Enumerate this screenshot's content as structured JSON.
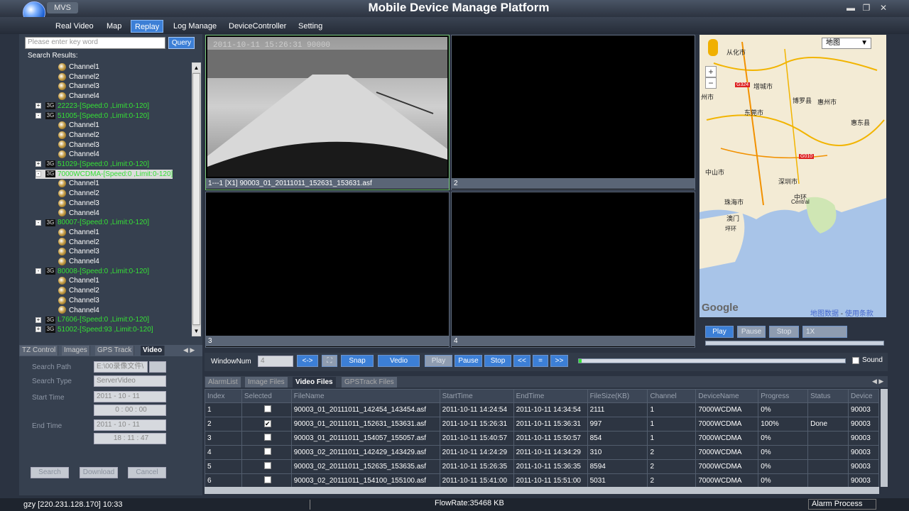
{
  "app": {
    "badge": "MVS",
    "title": "Mobile Device Manage Platform"
  },
  "menu": [
    "Real Video",
    "Map",
    "Replay",
    "Log Manage",
    "DeviceController",
    "Setting"
  ],
  "search": {
    "placeholder": "Please enter key word",
    "query_label": "Query",
    "results_label": "Search Results:"
  },
  "tree": [
    {
      "type": "ch",
      "label": "Channel1"
    },
    {
      "type": "ch",
      "label": "Channel2"
    },
    {
      "type": "ch",
      "label": "Channel3"
    },
    {
      "type": "ch",
      "label": "Channel4"
    },
    {
      "type": "dev",
      "expand": "+",
      "label": "22223-[Speed:0    ,Limit:0-120]"
    },
    {
      "type": "dev",
      "expand": "-",
      "label": "51005-[Speed:0    ,Limit:0-120]"
    },
    {
      "type": "ch",
      "label": "Channel1"
    },
    {
      "type": "ch",
      "label": "Channel2"
    },
    {
      "type": "ch",
      "label": "Channel3"
    },
    {
      "type": "ch",
      "label": "Channel4"
    },
    {
      "type": "dev",
      "expand": "+",
      "label": "51029-[Speed:0    ,Limit:0-120]"
    },
    {
      "type": "devsel",
      "expand": "-",
      "label": "7000WCDMA-[Speed:0    ,Limit:0-120]"
    },
    {
      "type": "ch",
      "label": "Channel1"
    },
    {
      "type": "ch",
      "label": "Channel2"
    },
    {
      "type": "ch",
      "label": "Channel3"
    },
    {
      "type": "ch",
      "label": "Channel4"
    },
    {
      "type": "dev",
      "expand": "-",
      "label": "80007-[Speed:0    ,Limit:0-120]"
    },
    {
      "type": "ch",
      "label": "Channel1"
    },
    {
      "type": "ch",
      "label": "Channel2"
    },
    {
      "type": "ch",
      "label": "Channel3"
    },
    {
      "type": "ch",
      "label": "Channel4"
    },
    {
      "type": "dev",
      "expand": "-",
      "label": "80008-[Speed:0    ,Limit:0-120]"
    },
    {
      "type": "ch",
      "label": "Channel1"
    },
    {
      "type": "ch",
      "label": "Channel2"
    },
    {
      "type": "ch",
      "label": "Channel3"
    },
    {
      "type": "ch",
      "label": "Channel4"
    },
    {
      "type": "dev",
      "expand": "+",
      "label": "L7606-[Speed:0    ,Limit:0-120]"
    },
    {
      "type": "dev",
      "expand": "+",
      "label": "51002-[Speed:93  ,Limit:0-120]"
    }
  ],
  "tree_badge": "3G",
  "left_tabs": [
    "TZ Control",
    "Images",
    "GPS Track",
    "Video"
  ],
  "video_form": {
    "search_path_label": "Search Path",
    "search_path_value": "E:\\00录像文件\\",
    "search_type_label": "Search Type",
    "search_type_value": "ServerVideo",
    "start_time_label": "Start Time",
    "start_date": "2011 - 10 - 11",
    "start_time": "0 : 00 : 00",
    "end_time_label": "End Time",
    "end_date": "2011 - 10 - 11",
    "end_time": "18 : 11 : 47",
    "search_btn": "Search",
    "download_btn": "Download",
    "cancel_btn": "Cancel"
  },
  "videos": [
    {
      "label": "1---1 [X1] 90003_01_20111011_152631_153631.asf"
    },
    {
      "label": "2"
    },
    {
      "label": "3"
    },
    {
      "label": "4"
    }
  ],
  "overlay_text": "2011-10-11 15:26:31  90000",
  "map": {
    "layer_select": "地图",
    "cities": [
      {
        "name": "从化市"
      },
      {
        "name": "增城市"
      },
      {
        "name": "博罗县"
      },
      {
        "name": "惠州市"
      },
      {
        "name": "东莞市"
      },
      {
        "name": "惠东县"
      },
      {
        "name": "中山市"
      },
      {
        "name": "深圳市"
      },
      {
        "name": "珠海市"
      },
      {
        "name": "澳门"
      },
      {
        "name": "中环"
      },
      {
        "name": "Central"
      },
      {
        "name": "州市"
      },
      {
        "name": "G324"
      },
      {
        "name": "G010"
      },
      {
        "name": "坪环"
      }
    ],
    "google": "Google",
    "credit1": "地图数据",
    "credit_sep": "-",
    "credit2": "使用条款",
    "zoom_in": "+",
    "zoom_out": "−"
  },
  "map_controls": {
    "play": "Play",
    "pause": "Pause",
    "stop": "Stop",
    "speed": "1X"
  },
  "controls": {
    "window_num_label": "WindowNum",
    "window_num_value": "4",
    "swap": "<->",
    "snap": "Snap",
    "vedio": "Vedio",
    "play": "Play",
    "pause": "Pause",
    "stop": "Stop",
    "prev": "<<",
    "eq": "=",
    "next": ">>",
    "sound": "Sound"
  },
  "bottom_tabs": [
    "AlarmList",
    "Image Files",
    "Video Files",
    "GPSTrack Files"
  ],
  "table": {
    "columns": [
      "Index",
      "Selected",
      "FileName",
      "StartTime",
      "EndTime",
      "FileSize(KB)",
      "Channel",
      "DeviceName",
      "Progress",
      "Status",
      "Device"
    ],
    "rows": [
      [
        "1",
        false,
        "90003_01_20111011_142454_143454.asf",
        "2011-10-11 14:24:54",
        "2011-10-11 14:34:54",
        "2111",
        "1",
        "7000WCDMA",
        "0%",
        "",
        "90003"
      ],
      [
        "2",
        true,
        "90003_01_20111011_152631_153631.asf",
        "2011-10-11 15:26:31",
        "2011-10-11 15:36:31",
        "997",
        "1",
        "7000WCDMA",
        "100%",
        "Done",
        "90003"
      ],
      [
        "3",
        false,
        "90003_01_20111011_154057_155057.asf",
        "2011-10-11 15:40:57",
        "2011-10-11 15:50:57",
        "854",
        "1",
        "7000WCDMA",
        "0%",
        "",
        "90003"
      ],
      [
        "4",
        false,
        "90003_02_20111011_142429_143429.asf",
        "2011-10-11 14:24:29",
        "2011-10-11 14:34:29",
        "310",
        "2",
        "7000WCDMA",
        "0%",
        "",
        "90003"
      ],
      [
        "5",
        false,
        "90003_02_20111011_152635_153635.asf",
        "2011-10-11 15:26:35",
        "2011-10-11 15:36:35",
        "8594",
        "2",
        "7000WCDMA",
        "0%",
        "",
        "90003"
      ],
      [
        "6",
        false,
        "90003_02_20111011_154100_155100.asf",
        "2011-10-11 15:41:00",
        "2011-10-11 15:51:00",
        "5031",
        "2",
        "7000WCDMA",
        "0%",
        "",
        "90003"
      ]
    ]
  },
  "status": {
    "user": "gzy [220.231.128.170]  10:33",
    "flowrate": "FlowRate:35468 KB",
    "alarm": "Alarm Process"
  },
  "colors": {
    "accent": "#3c7fd6",
    "tree_device": "#35e035",
    "bg": "#2b3341"
  }
}
